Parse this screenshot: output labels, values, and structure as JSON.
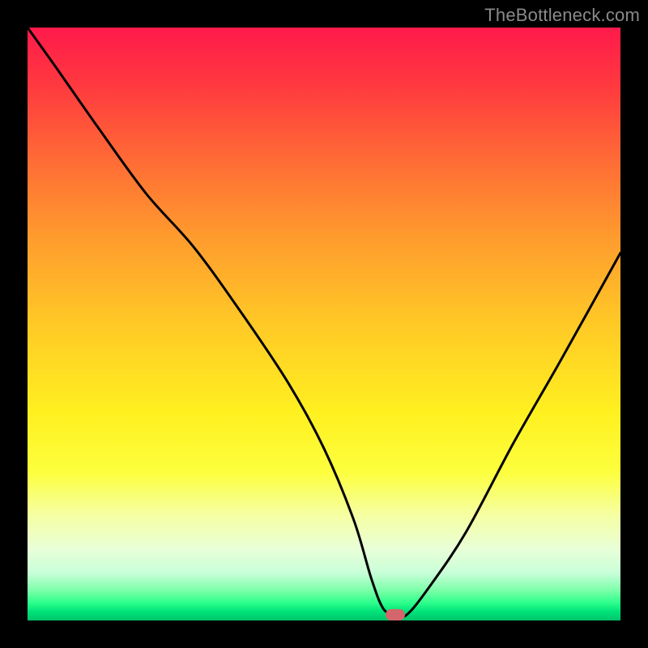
{
  "watermark": "TheBottleneck.com",
  "marker": {
    "color": "#d4666b",
    "x_pct": 62,
    "y_pct": 99
  },
  "chart_data": {
    "type": "line",
    "title": "",
    "xlabel": "",
    "ylabel": "",
    "xlim": [
      0,
      100
    ],
    "ylim": [
      0,
      100
    ],
    "grid": false,
    "legend": false,
    "series": [
      {
        "name": "bottleneck-curve",
        "x": [
          0,
          5,
          12,
          20,
          28,
          36,
          44,
          50,
          55,
          58,
          60,
          62,
          64,
          68,
          74,
          82,
          90,
          100
        ],
        "y": [
          100,
          93,
          83,
          72,
          63,
          52,
          40,
          29,
          17,
          7,
          2,
          1,
          1,
          6,
          15,
          30,
          44,
          62
        ]
      }
    ],
    "annotations": [
      {
        "type": "marker",
        "x": 62,
        "y": 1,
        "shape": "pill",
        "color": "#d4666b"
      }
    ],
    "background_gradient": {
      "direction": "vertical",
      "stops": [
        {
          "pct": 0,
          "color": "#ff1a4b"
        },
        {
          "pct": 50,
          "color": "#ffc926"
        },
        {
          "pct": 82,
          "color": "#f6ffa0"
        },
        {
          "pct": 100,
          "color": "#00c46a"
        }
      ]
    }
  }
}
